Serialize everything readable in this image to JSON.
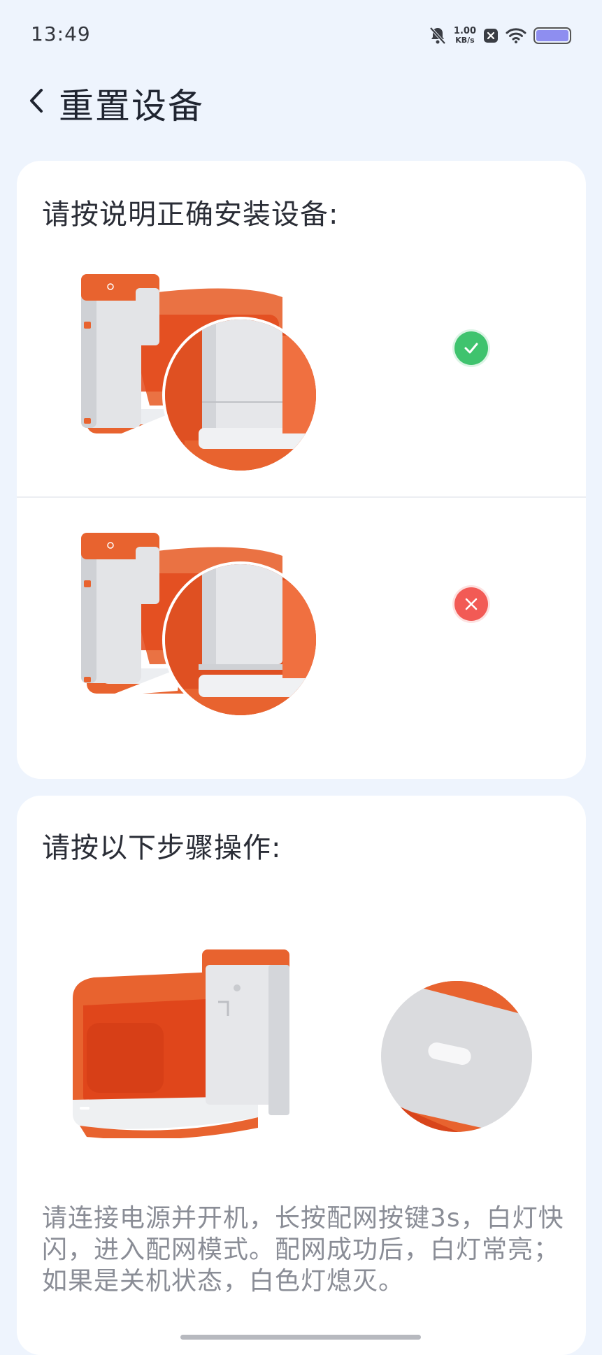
{
  "status_bar": {
    "time": "13:49",
    "net_speed_value": "1.00",
    "net_speed_unit": "KB/s",
    "icons": [
      "bell-muted-icon",
      "app-notification-icon",
      "wifi-icon",
      "battery-icon"
    ]
  },
  "nav": {
    "back_icon": "chevron-left-icon",
    "title": "重置设备"
  },
  "install_section": {
    "heading": "请按说明正确安装设备:",
    "items": [
      {
        "status": "correct",
        "icon": "checkmark-icon",
        "color": "#3fc36e"
      },
      {
        "status": "incorrect",
        "icon": "cross-icon",
        "color": "#f25a55"
      }
    ]
  },
  "steps_section": {
    "heading": "请按以下步骤操作:",
    "instructions": "请连接电源并开机，长按配网按键3s，白灯快闪，进入配网模式。配网成功后，白灯常亮；\n如果是关机状态，白色灯熄灭。"
  },
  "colors": {
    "accent_orange": "#e8632f",
    "device_gray": "#dedfe2",
    "background": "#eef4fd"
  }
}
